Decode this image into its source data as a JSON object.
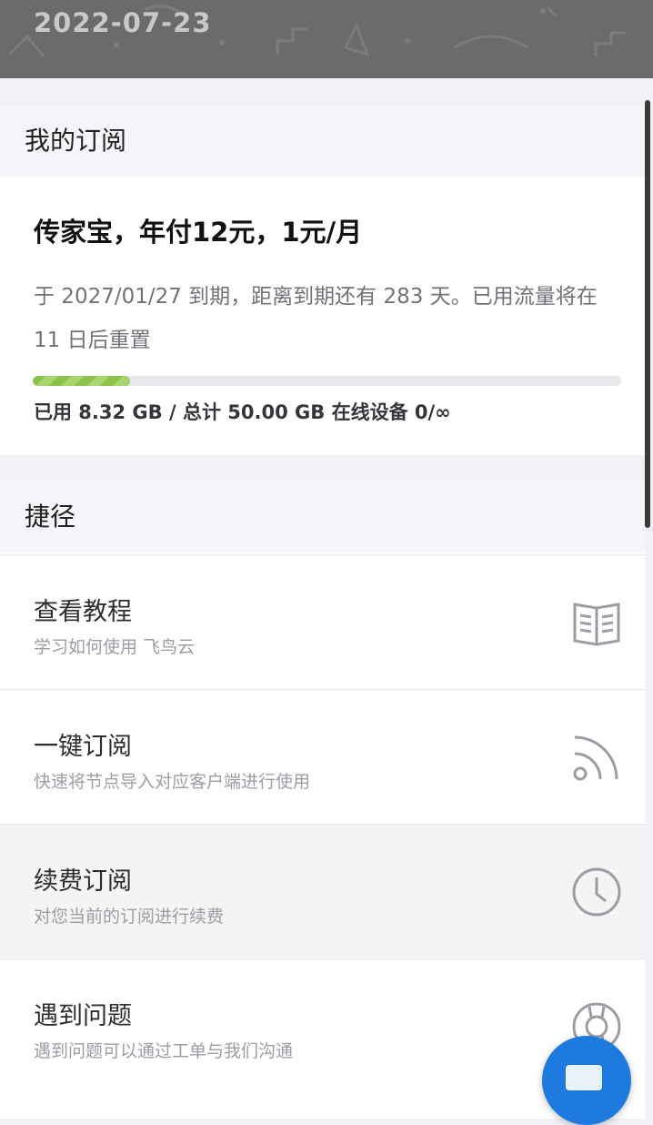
{
  "header": {
    "date": "2022-07-23"
  },
  "subscription": {
    "heading": "我的订阅",
    "plan_title": "传家宝，年付12元，1元/月",
    "description": "于 2027/01/27 到期，距离到期还有 283 天。已用流量将在 11 日后重置",
    "usage_text": "已用 8.32 GB / 总计 50.00 GB 在线设备 0/∞",
    "used_fraction": 0.166
  },
  "shortcuts": {
    "heading": "捷径",
    "items": [
      {
        "title": "查看教程",
        "subtitle": "学习如何使用 飞鸟云",
        "icon": "book-icon"
      },
      {
        "title": "一键订阅",
        "subtitle": "快速将节点导入对应客户端进行使用",
        "icon": "rss-icon"
      },
      {
        "title": "续费订阅",
        "subtitle": "对您当前的订阅进行续费",
        "icon": "clock-icon"
      },
      {
        "title": "遇到问题",
        "subtitle": "遇到问题可以通过工单与我们沟通",
        "icon": "lifebuoy-icon"
      }
    ]
  },
  "colors": {
    "accent": "#1f7ae0",
    "progress": "#8bc34a"
  }
}
